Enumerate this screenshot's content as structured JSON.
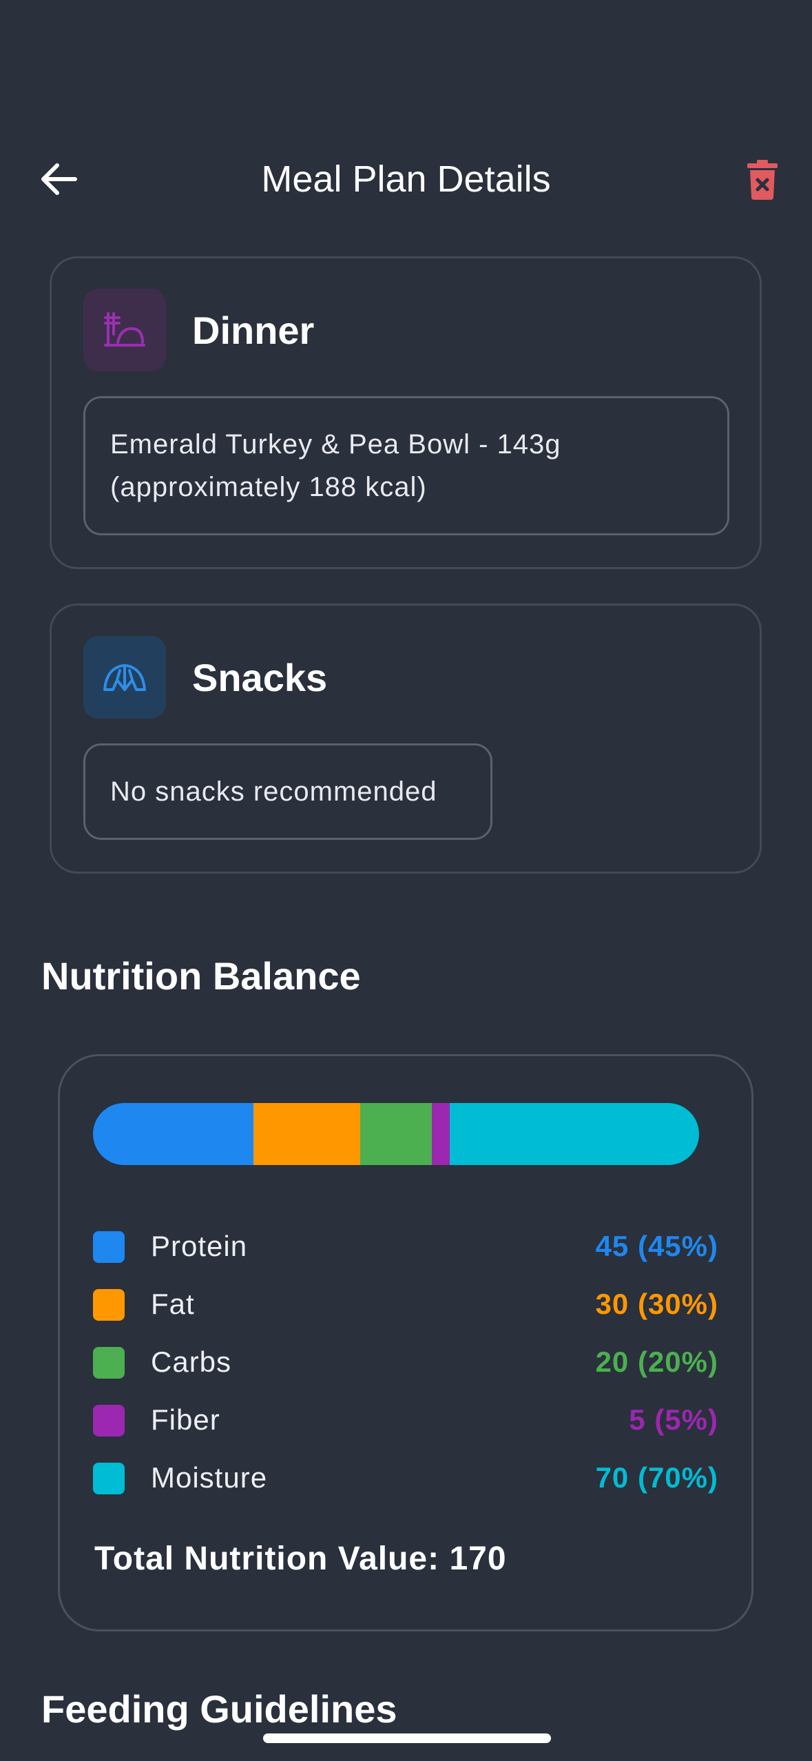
{
  "header": {
    "title": "Meal Plan Details",
    "back_icon": "arrow-left-icon",
    "delete_icon": "trash-x-icon",
    "delete_color": "#e05a5f"
  },
  "meals": [
    {
      "name": "Dinner",
      "icon": "dinner-plate-icon",
      "icon_color": "#9b2fb0",
      "description": "Emerald Turkey & Pea Bowl - 143g (approximately 188 kcal)"
    },
    {
      "name": "Snacks",
      "icon": "croissant-icon",
      "icon_color": "#2e8de8",
      "description": "No snacks recommended"
    }
  ],
  "nutrition": {
    "title": "Nutrition Balance",
    "items": [
      {
        "label": "Protein",
        "value": "45 (45%)",
        "amount": 45,
        "color": "#1e88f0"
      },
      {
        "label": "Fat",
        "value": "30 (30%)",
        "amount": 30,
        "color": "#ff9800"
      },
      {
        "label": "Carbs",
        "value": "20 (20%)",
        "amount": 20,
        "color": "#4caf50"
      },
      {
        "label": "Fiber",
        "value": "5 (5%)",
        "amount": 5,
        "color": "#9c27b0"
      },
      {
        "label": "Moisture",
        "value": "70 (70%)",
        "amount": 70,
        "color": "#00bcd4"
      }
    ],
    "total": "Total Nutrition Value: 170"
  },
  "feeding": {
    "title": "Feeding Guidelines"
  }
}
